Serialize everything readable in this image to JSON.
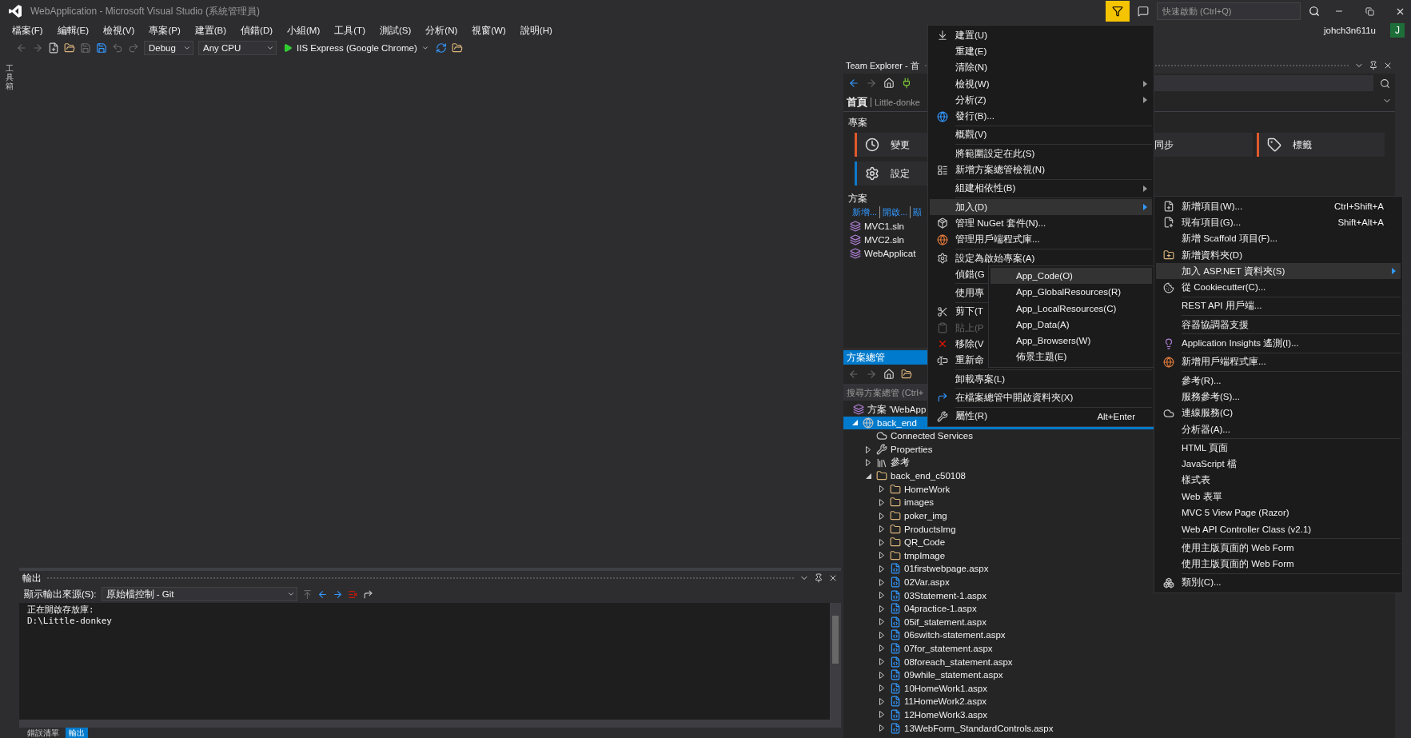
{
  "window": {
    "title": "WebApplication - Microsoft Visual Studio (系統管理員)",
    "quick_launch": {
      "placeholder": "快速啟動 (Ctrl+Q)"
    },
    "user": "johch3n611u",
    "avatar": "J"
  },
  "menu_bar": [
    "檔案(F)",
    "編輯(E)",
    "檢視(V)",
    "專案(P)",
    "建置(B)",
    "偵錯(D)",
    "小組(M)",
    "工具(T)",
    "測試(S)",
    "分析(N)",
    "視窗(W)",
    "說明(H)"
  ],
  "toolbar": {
    "configuration": "Debug",
    "platform": "Any CPU",
    "run_target": "IIS Express (Google Chrome)"
  },
  "left_tab": "工具箱",
  "output": {
    "title": "輸出",
    "source_label": "顯示輸出來源(S):",
    "source": "原始檔控制 - Git",
    "lines": [
      "正在開啟存放庫:",
      "D:\\Little-donkey"
    ],
    "tabs": [
      {
        "label": "錯誤清單",
        "selected": false
      },
      {
        "label": "輸出",
        "selected": true
      }
    ]
  },
  "team_explorer": {
    "title": "Team Explorer - 首",
    "page": "首頁",
    "repo": "Little-donke",
    "project_section": "專案",
    "card_rows": [
      [
        {
          "label": "變更",
          "kind": "changes",
          "color": "#e0592a"
        },
        {
          "label": "同步",
          "kind": "sync"
        },
        {
          "label": "標籤",
          "kind": "tags",
          "color": "#e0592a"
        }
      ],
      [
        {
          "label": "設定",
          "kind": "settings",
          "color": "#0e7acc"
        }
      ]
    ],
    "solution_section": "方案",
    "links": [
      "新增...",
      "開啟...",
      "顯"
    ],
    "solutions": [
      "MVC1.sln",
      "MVC2.sln",
      "WebApplicat"
    ]
  },
  "solution_explorer": {
    "title": "方案總管",
    "search": {
      "placeholder": "搜尋方案總管 (Ctrl+"
    },
    "tree": [
      {
        "label": "方案 'WebApp",
        "kind": "solution",
        "selected": false,
        "children": [
          {
            "label": "back_end",
            "kind": "project",
            "expanded": true,
            "selected": true,
            "children": [
              {
                "label": "Connected Services",
                "kind": "service",
                "selected": false
              },
              {
                "label": "Properties",
                "kind": "properties",
                "expanded": false,
                "selected": false
              },
              {
                "label": "參考",
                "kind": "references",
                "expanded": false,
                "selected": false
              },
              {
                "label": "back_end_c50108",
                "kind": "folder",
                "expanded": true,
                "selected": false,
                "children": [
                  {
                    "label": "HomeWork",
                    "kind": "folder",
                    "expanded": false,
                    "selected": false
                  },
                  {
                    "label": "images",
                    "kind": "folder",
                    "expanded": false,
                    "selected": false
                  },
                  {
                    "label": "poker_img",
                    "kind": "folder",
                    "expanded": false,
                    "selected": false
                  },
                  {
                    "label": "ProductsImg",
                    "kind": "folder",
                    "expanded": false,
                    "selected": false
                  },
                  {
                    "label": "QR_Code",
                    "kind": "folder",
                    "expanded": false,
                    "selected": false
                  },
                  {
                    "label": "tmpImage",
                    "kind": "folder",
                    "expanded": false,
                    "selected": false
                  },
                  {
                    "label": "01firstwebpage.aspx",
                    "kind": "page",
                    "expanded": false,
                    "selected": false
                  },
                  {
                    "label": "02Var.aspx",
                    "kind": "page",
                    "expanded": false,
                    "selected": false
                  },
                  {
                    "label": "03Statement-1.aspx",
                    "kind": "page",
                    "expanded": false,
                    "selected": false
                  },
                  {
                    "label": "04practice-1.aspx",
                    "kind": "page",
                    "expanded": false,
                    "selected": false
                  },
                  {
                    "label": "05if_statement.aspx",
                    "kind": "page",
                    "expanded": false,
                    "selected": false
                  },
                  {
                    "label": "06switch-statement.aspx",
                    "kind": "page",
                    "expanded": false,
                    "selected": false
                  },
                  {
                    "label": "07for_statement.aspx",
                    "kind": "page",
                    "expanded": false,
                    "selected": false
                  },
                  {
                    "label": "08foreach_statement.aspx",
                    "kind": "page",
                    "expanded": false,
                    "selected": false
                  },
                  {
                    "label": "09while_statement.aspx",
                    "kind": "page",
                    "expanded": false,
                    "selected": false
                  },
                  {
                    "label": "10HomeWork1.aspx",
                    "kind": "page",
                    "expanded": false,
                    "selected": false
                  },
                  {
                    "label": "11HomeWork2.aspx",
                    "kind": "page",
                    "expanded": false,
                    "selected": false
                  },
                  {
                    "label": "12HomeWork3.aspx",
                    "kind": "page",
                    "expanded": false,
                    "selected": false
                  },
                  {
                    "label": "13WebForm_StandardControls.aspx",
                    "kind": "page",
                    "expanded": false,
                    "selected": false
                  }
                ]
              }
            ]
          }
        ]
      }
    ]
  },
  "context_menu": {
    "groups": [
      [
        {
          "label": "建置(U)",
          "submenu": false,
          "selected": false,
          "disabled": false
        },
        {
          "label": "重建(E)",
          "submenu": false,
          "selected": false,
          "disabled": false
        },
        {
          "label": "清除(N)",
          "submenu": false,
          "selected": false,
          "disabled": false
        },
        {
          "label": "檢視(W)",
          "submenu": true,
          "selected": false,
          "disabled": false
        },
        {
          "label": "分析(Z)",
          "submenu": true,
          "selected": false,
          "disabled": false
        },
        {
          "label": "發行(B)...",
          "submenu": false,
          "selected": false,
          "disabled": false
        }
      ],
      [
        {
          "label": "概觀(V)",
          "submenu": false,
          "selected": false,
          "disabled": false
        }
      ],
      [
        {
          "label": "將範圍設定在此(S)",
          "submenu": false,
          "selected": false,
          "disabled": false
        },
        {
          "label": "新增方案總管檢視(N)",
          "submenu": false,
          "selected": false,
          "disabled": false
        }
      ],
      [
        {
          "label": "組建相依性(B)",
          "submenu": true,
          "selected": false,
          "disabled": false
        }
      ],
      [
        {
          "label": "加入(D)",
          "submenu": true,
          "selected": true,
          "disabled": false
        },
        {
          "label": "管理 NuGet 套件(N)...",
          "submenu": false,
          "selected": false,
          "disabled": false
        },
        {
          "label": "管理用戶端程式庫...",
          "submenu": false,
          "selected": false,
          "disabled": false
        }
      ],
      [
        {
          "label": "設定為啟始專案(A)",
          "submenu": false,
          "selected": false,
          "disabled": false
        },
        {
          "label": "偵錯(G",
          "selected": false,
          "disabled": false
        }
      ],
      [
        {
          "label": "使用專",
          "selected": false,
          "disabled": false
        }
      ],
      [
        {
          "label": "剪下(T",
          "selected": false,
          "disabled": false
        },
        {
          "label": "貼上(P",
          "selected": false,
          "disabled": true
        },
        {
          "label": "移除(V",
          "selected": false,
          "disabled": false
        },
        {
          "label": "重新命",
          "selected": false,
          "disabled": false
        }
      ],
      [
        {
          "label": "卸載專案(L)",
          "submenu": false,
          "selected": false,
          "disabled": false
        }
      ],
      [
        {
          "label": "在檔案總管中開啟資料夾(X)",
          "submenu": false,
          "selected": false,
          "disabled": false
        }
      ],
      [
        {
          "label": "屬性(R)",
          "shortcut": "Alt+Enter",
          "submenu": false,
          "selected": false,
          "disabled": false
        }
      ]
    ]
  },
  "add_submenu": {
    "groups": [
      [
        {
          "label": "新增項目(W)...",
          "shortcut": "Ctrl+Shift+A",
          "submenu": false,
          "selected": false
        },
        {
          "label": "現有項目(G)...",
          "shortcut": "Shift+Alt+A",
          "submenu": false,
          "selected": false
        },
        {
          "label": "新增 Scaffold 項目(F)...",
          "submenu": false,
          "selected": false
        },
        {
          "label": "新增資料夾(D)",
          "submenu": false,
          "selected": false
        },
        {
          "label": "加入 ASP.NET 資料夾(S)",
          "submenu": true,
          "selected": true
        },
        {
          "label": "從 Cookiecutter(C)...",
          "submenu": false,
          "selected": false
        }
      ],
      [
        {
          "label": "REST API 用戶端...",
          "submenu": false,
          "selected": false
        }
      ],
      [
        {
          "label": "容器協調器支援",
          "submenu": false,
          "selected": false
        }
      ],
      [
        {
          "label": "Application Insights 遙測(I)...",
          "submenu": false,
          "selected": false
        }
      ],
      [
        {
          "label": "新增用戶端程式庫...",
          "submenu": false,
          "selected": false
        }
      ],
      [
        {
          "label": "參考(R)...",
          "submenu": false,
          "selected": false
        },
        {
          "label": "服務參考(S)...",
          "submenu": false,
          "selected": false
        },
        {
          "label": "連線服務(C)",
          "submenu": false,
          "selected": false
        },
        {
          "label": "分析器(A)...",
          "submenu": false,
          "selected": false
        }
      ],
      [
        {
          "label": "HTML 頁面",
          "submenu": false,
          "selected": false
        },
        {
          "label": "JavaScript 檔",
          "submenu": false,
          "selected": false
        },
        {
          "label": "樣式表",
          "submenu": false,
          "selected": false
        },
        {
          "label": "Web 表單",
          "submenu": false,
          "selected": false
        },
        {
          "label": "MVC 5 View Page (Razor)",
          "submenu": false,
          "selected": false
        },
        {
          "label": "Web API Controller Class (v2.1)",
          "submenu": false,
          "selected": false
        }
      ],
      [
        {
          "label": "使用主版頁面的 Web Form",
          "submenu": false,
          "selected": false
        },
        {
          "label": "使用主版頁面的 Web Form",
          "submenu": false,
          "selected": false
        }
      ],
      [
        {
          "label": "類別(C)...",
          "submenu": false,
          "selected": false
        }
      ]
    ]
  },
  "folder_submenu": {
    "items": [
      {
        "label": "App_Code(O)",
        "selected": true
      },
      {
        "label": "App_GlobalResources(R)",
        "selected": false
      },
      {
        "label": "App_LocalResources(C)",
        "selected": false
      },
      {
        "label": "App_Data(A)",
        "selected": false
      },
      {
        "label": "App_Browsers(W)",
        "selected": false
      },
      {
        "label": "佈景主題(E)",
        "selected": false
      }
    ]
  }
}
